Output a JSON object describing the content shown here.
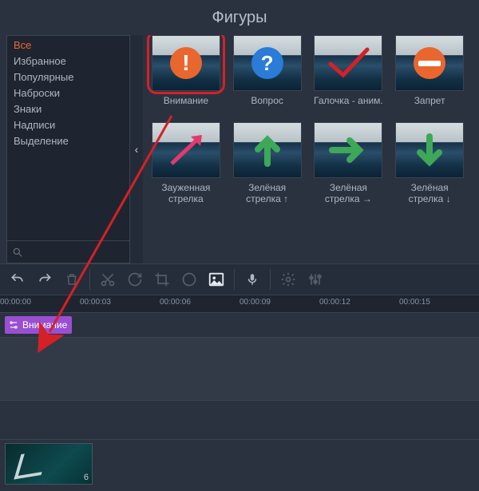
{
  "panel_title": "Фигуры",
  "categories": [
    {
      "label": "Все",
      "active": true
    },
    {
      "label": "Избранное",
      "active": false
    },
    {
      "label": "Популярные",
      "active": false
    },
    {
      "label": "Наброски",
      "active": false
    },
    {
      "label": "Знаки",
      "active": false
    },
    {
      "label": "Надписи",
      "active": false
    },
    {
      "label": "Выделение",
      "active": false
    }
  ],
  "search_placeholder": "",
  "collapse_glyph": "‹",
  "shapes": [
    {
      "label": "Внимание",
      "icon": "attention",
      "highlighted": true
    },
    {
      "label": "Вопрос",
      "icon": "question",
      "highlighted": false
    },
    {
      "label": "Галочка - аним.",
      "icon": "check",
      "highlighted": false
    },
    {
      "label": "Запрет",
      "icon": "forbid",
      "highlighted": false
    },
    {
      "label": "Зауженная стрелка",
      "icon": "arrow-red",
      "highlighted": false
    },
    {
      "label": "Зелёная стрелка ↑",
      "icon": "arrow-up",
      "highlighted": false
    },
    {
      "label": "Зелёная стрелка →",
      "icon": "arrow-right",
      "highlighted": false
    },
    {
      "label": "Зелёная стрелка ↓",
      "icon": "arrow-down",
      "highlighted": false
    }
  ],
  "toolbar": {
    "undo": "undo",
    "redo": "redo",
    "delete": "delete",
    "cut": "cut",
    "rotate": "rotate",
    "crop": "crop",
    "color": "color",
    "image": "image",
    "mic": "mic",
    "settings": "settings",
    "equalizer": "equalizer"
  },
  "ruler_marks": [
    "00:00:00",
    "00:00:03",
    "00:00:06",
    "00:00:09",
    "00:00:12",
    "00:00:15"
  ],
  "title_clip": {
    "label": "Внимание"
  },
  "video_clip": {
    "duration_label": "6"
  }
}
